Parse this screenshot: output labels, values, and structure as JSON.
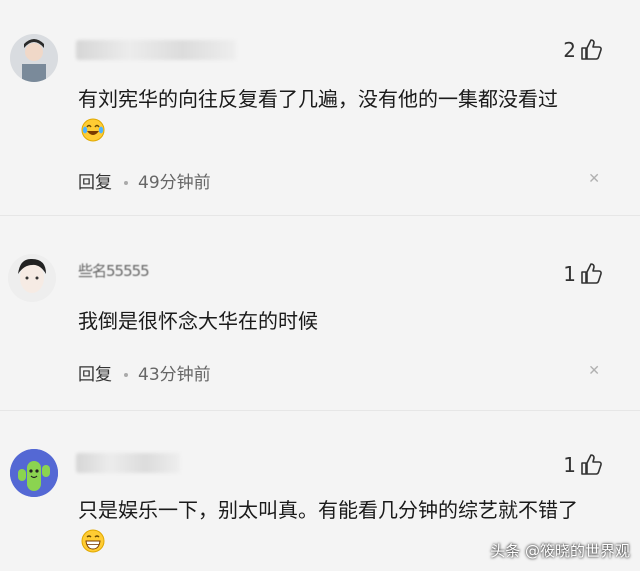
{
  "comments": [
    {
      "likes": "2",
      "text": "有刘宪华的向往反复看了几遍，没有他的一集都没看过",
      "emoji": "laughing-tears-icon",
      "reply_label": "回复",
      "time": "49分钟前"
    },
    {
      "username": "些名55555",
      "likes": "1",
      "text": "我倒是很怀念大华在的时候",
      "reply_label": "回复",
      "time": "43分钟前"
    },
    {
      "likes": "1",
      "text": "只是娱乐一下，别太叫真。有能看几分钟的综艺就不错了",
      "emoji": "grinning-face-icon"
    }
  ],
  "watermark": "头条 @筱晓的世界观"
}
